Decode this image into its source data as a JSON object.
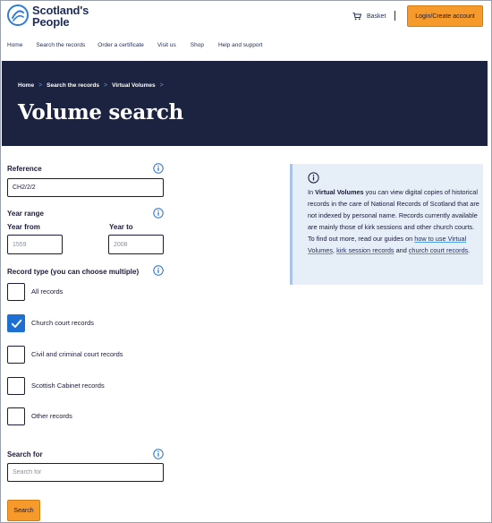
{
  "header": {
    "logo_line1": "Scotland's",
    "logo_line2": "People",
    "basket_label": "Basket",
    "login_label": "Login/Create account"
  },
  "nav": {
    "items": [
      {
        "label": "Home"
      },
      {
        "label": "Search the records"
      },
      {
        "label": "Order a certificate"
      },
      {
        "label": "Visit us"
      },
      {
        "label": "Shop"
      },
      {
        "label": "Help and support"
      }
    ]
  },
  "hero": {
    "breadcrumbs": [
      "Home",
      "Search the records",
      "Virtual Volumes"
    ],
    "title": "Volume search"
  },
  "form": {
    "reference": {
      "label": "Reference",
      "value": "CH2/2/2"
    },
    "year_range": {
      "label": "Year range",
      "from_label": "Year from",
      "from_placeholder": "1559",
      "to_label": "Year to",
      "to_placeholder": "2008"
    },
    "record_type": {
      "label": "Record type (you can choose multiple)",
      "options": [
        {
          "label": "All records",
          "checked": false
        },
        {
          "label": "Church court records",
          "checked": true
        },
        {
          "label": "Civil and criminal court records",
          "checked": false
        },
        {
          "label": "Scottish Cabinet records",
          "checked": false
        },
        {
          "label": "Other records",
          "checked": false
        }
      ]
    },
    "search_for": {
      "label": "Search for",
      "placeholder": "Search for"
    },
    "search_button": "Search"
  },
  "info_panel": {
    "intro": "In ",
    "highlight": "Virtual Volumes",
    "body": " you can view digital copies of historical records in the care of National Records of Scotland that are not indexed by personal name. Records currently available are mainly those of kirk sessions and other church courts. To find out more, read our guides on ",
    "link1": "how to use Virtual Volumes",
    "sep1": ", ",
    "link2": "kirk session records",
    "sep2": " and ",
    "link3": "church court records",
    "end": "."
  },
  "colors": {
    "brand_navy": "#1c2340",
    "accent_orange": "#f59a2b",
    "check_blue": "#1f6fd0",
    "info_bg": "#e6eef8"
  }
}
